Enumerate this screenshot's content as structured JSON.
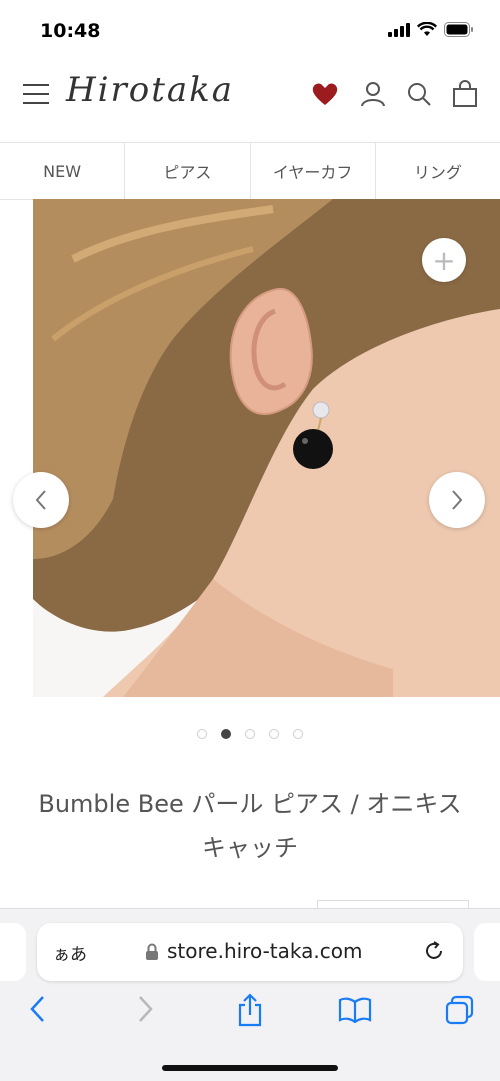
{
  "status": {
    "time": "10:48"
  },
  "header": {
    "logo": "Hirotaka",
    "icons": [
      "menu-icon",
      "heart-icon",
      "account-icon",
      "search-icon",
      "bag-icon"
    ],
    "heart_color": "#9b1b1f"
  },
  "nav": {
    "tabs": [
      "NEW",
      "ピアス",
      "イヤーカフ",
      "リング"
    ]
  },
  "gallery": {
    "slide_count": 5,
    "active_slide": 2
  },
  "product": {
    "title": "Bumble Bee パール ピアス / オニキス キャッチ"
  },
  "browser": {
    "aa_label": "ぁあ",
    "url": "store.hiro-taka.com",
    "accent": "#1a7cf5"
  }
}
